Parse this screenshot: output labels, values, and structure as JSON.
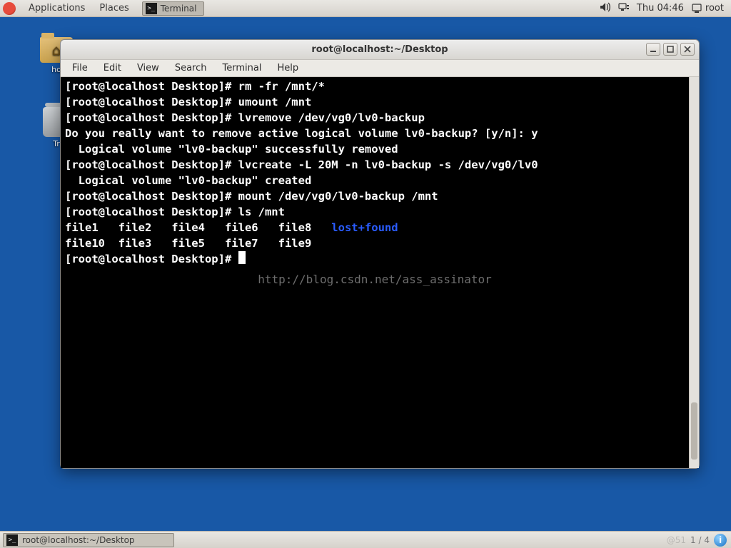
{
  "top": {
    "applications": "Applications",
    "places": "Places",
    "task_label": "Terminal",
    "clock": "Thu 04:46",
    "user": "root"
  },
  "desktop": {
    "home_label": "ho",
    "trash_label": "Tr"
  },
  "window": {
    "title": "root@localhost:~/Desktop",
    "menu": {
      "file": "File",
      "edit": "Edit",
      "view": "View",
      "search": "Search",
      "terminal": "Terminal",
      "help": "Help"
    }
  },
  "terminal": {
    "prompt": "[root@localhost Desktop]#",
    "lines": [
      "[root@localhost Desktop]# rm -fr /mnt/*",
      "[root@localhost Desktop]# umount /mnt",
      "[root@localhost Desktop]# lvremove /dev/vg0/lv0-backup",
      "Do you really want to remove active logical volume lv0-backup? [y/n]: y",
      "  Logical volume \"lv0-backup\" successfully removed",
      "[root@localhost Desktop]# lvcreate -L 20M -n lv0-backup -s /dev/vg0/lv0",
      "  Logical volume \"lv0-backup\" created",
      "[root@localhost Desktop]# mount /dev/vg0/lv0-backup /mnt",
      "[root@localhost Desktop]# ls /mnt"
    ],
    "ls_row1_white": "file1   file2   file4   file6   file8   ",
    "ls_row1_blue": "lost+found",
    "ls_row2": "file10  file3   file5   file7   file9",
    "watermark": "http://blog.csdn.net/ass_assinator"
  },
  "bottom": {
    "task_label": "root@localhost:~/Desktop",
    "workspace": "1 / 4",
    "faded": "@51"
  }
}
